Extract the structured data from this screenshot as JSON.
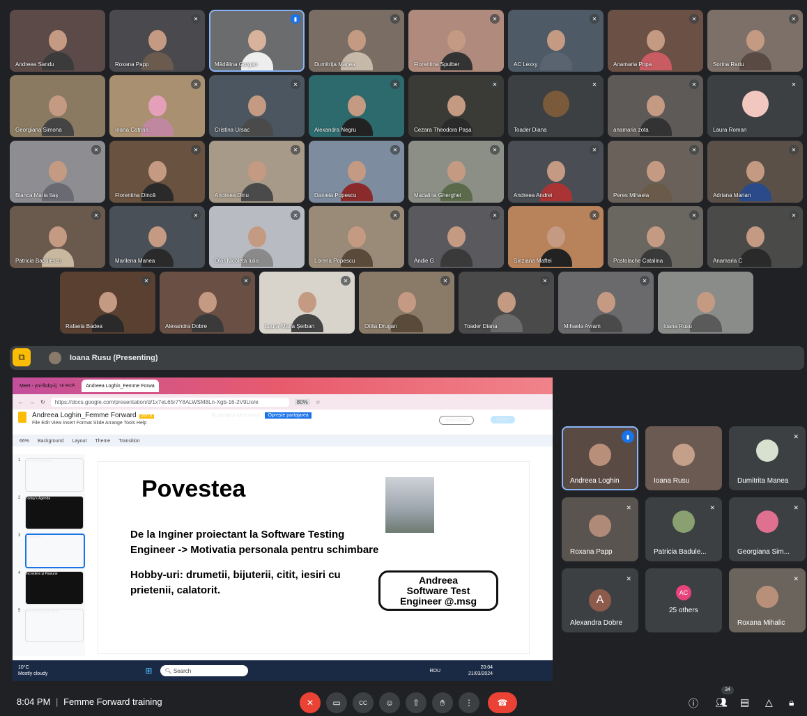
{
  "grid": {
    "row1": [
      "Andreea Sandu",
      "Roxana Papp",
      "Mădălina Gorgan",
      "Dumitrița Manea",
      "Florentina Spulber",
      "AC Lexxy",
      "Anamaria Popa",
      "Sorina Radu"
    ],
    "row2": [
      "Georgiana Simona",
      "Ioana Catrina",
      "Cristina Ursac",
      "Alexandra Negru",
      "Cezara Theodora Pașa",
      "Toader Diana",
      "anamaria zota",
      "Laura Roman"
    ],
    "row3": [
      "Bianca Maria Ilaș",
      "Florentina Dincă",
      "Andreea Dinu",
      "Daniela Popescu",
      "Madalina Gherghel",
      "Andreea Andrei",
      "Peres Mihaela",
      "Adriana Marian"
    ],
    "row4": [
      "Patricia Badulescu",
      "Marilena Manea",
      "Olar Nicoleta Iulia",
      "Lorena Popescu",
      "Andie G",
      "Sinziana Maftei",
      "Postolache Catalina",
      "Anamaria C"
    ],
    "row5": [
      "Rafaela Badea",
      "Alexandra Dobre",
      "Laura-Maria Șerban",
      "Otilia Drugan",
      "Toader Diana",
      "Mihaela Avram",
      "Ioana Rusu"
    ]
  },
  "presenting": {
    "label": "Ioana Rusu (Presenting)"
  },
  "browser": {
    "tab1": "Meet - yni-fkdq-iij",
    "tab1_sub": "SE REDĂ",
    "tab2": "Andreea Loghin_Femme Forwa",
    "url": "https://docs.google.com/presentation/d/1x7eL65r7Y8ALWSM8Ln-Xgb-16-2V9Llo/e",
    "zoom": "80%"
  },
  "slides_app": {
    "doc_title": "Andreea Loghin_Femme Forward",
    "doc_type": ".PPTX",
    "menu": "File  Edit  View  Insert  Format  Slide  Arrange  Tools  Help",
    "share_msg": "Îți partajezi tot ecranul.",
    "stop_share": "Oprește partajarea",
    "slideshow": "Slideshow",
    "share": "Share",
    "toolbar_zoom": "66%",
    "toolbar_items": [
      "Background",
      "Layout",
      "Theme",
      "Transition"
    ]
  },
  "thumbnails": [
    {
      "num": "1",
      "text": "Femme Forward"
    },
    {
      "num": "2",
      "text": "Today's Agenda"
    },
    {
      "num": "3",
      "text": "Povestea"
    },
    {
      "num": "4",
      "text": "Încredere și Pasiune"
    },
    {
      "num": "5",
      "text": "Securitate și Mindset"
    }
  ],
  "slide": {
    "title": "Povestea",
    "line1": "De la Inginer proiectant la Software Testing",
    "line2": "Engineer -> Motivatia personala pentru schimbare",
    "line3": "Hobby-uri: drumetii, bijuterii, citit, iesiri cu",
    "line4": "prietenii, calatorit.",
    "badge1": "Andreea",
    "badge2": "Software Test",
    "badge3": "Engineer @.msg"
  },
  "taskbar": {
    "temp": "10°C",
    "weather": "Mostly cloudy",
    "search": "Search",
    "lang": "ROU",
    "time": "20:04",
    "date": "21/03/2024"
  },
  "right_tiles": [
    "Andreea Loghin",
    "Ioana Rusu",
    "Dumitrita Manea",
    "Roxana Papp",
    "Patricia Badule...",
    "Georgiana Sim...",
    "Alexandra Dobre",
    "25 others",
    "Roxana Mihalic"
  ],
  "right_extra": {
    "avatar_letter": "A",
    "others_avatar": "AC"
  },
  "bottom": {
    "time": "8:04 PM",
    "separator": "|",
    "meeting": "Femme Forward training",
    "people_count": "34"
  }
}
